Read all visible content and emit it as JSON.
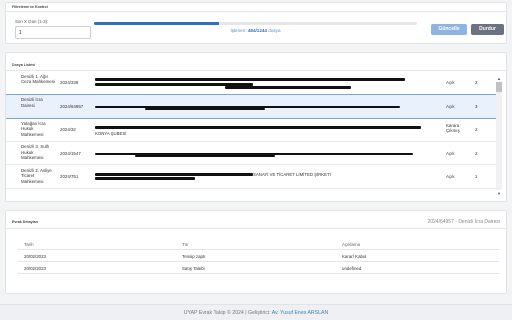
{
  "filter": {
    "title": "Filtreleme ve Kontrol",
    "days_label": "Son X Gün (1-3):",
    "days_value": "1",
    "progress_fraction": 0.388,
    "progress_prefix": "İşlenen: ",
    "progress_count": "484/1244",
    "progress_suffix": " dosya",
    "update_button": "Güncelle",
    "stop_button": "Durdur"
  },
  "list": {
    "title": "Dosya Listesi",
    "rows": [
      {
        "court": "Denizli 1. Ağır Ceza Mahkemesi",
        "case_no": "2024/338",
        "party_text": "",
        "status": "Açık",
        "count": "2"
      },
      {
        "court": "Denizli İcra Dairesi",
        "case_no": "2024/64957",
        "party_text": "",
        "status": "Açık",
        "count": "3"
      },
      {
        "court": "Yatağan İcra Hukuk Mahkemesi",
        "case_no": "2024/32",
        "party_text": "KONYA ŞUBESİ",
        "status": "Karara Çıkmış",
        "count": "2"
      },
      {
        "court": "Denizli 3. Sulh Hukuk Mahkemesi",
        "case_no": "2024/1547",
        "party_text": "",
        "status": "Açık",
        "count": "2"
      },
      {
        "court": "Denizli 2. Asliye Ticaret Mahkemesi",
        "case_no": "2024/751",
        "party_text": "SANAYİ VE TİCARET LİMİTED ŞİRKETİ",
        "status": "Açık",
        "count": "1"
      }
    ]
  },
  "detail": {
    "title": "Evrak Detayları",
    "case_title": "2024/64957 - Denizli İcra Dairesi",
    "columns": [
      "Tarih",
      "Tür",
      "Açıklama"
    ],
    "rows": [
      [
        "20/02/2023",
        "Tensip zaptı",
        "Karar/ Kabul"
      ],
      [
        "20/02/2023",
        "Satış Talebi",
        "undefined"
      ]
    ]
  },
  "footer": {
    "text": "UYAP Evrak Takip © 2024 | Geliştirici: ",
    "developer": "Av. Yusuf Enes ARSLAN"
  }
}
